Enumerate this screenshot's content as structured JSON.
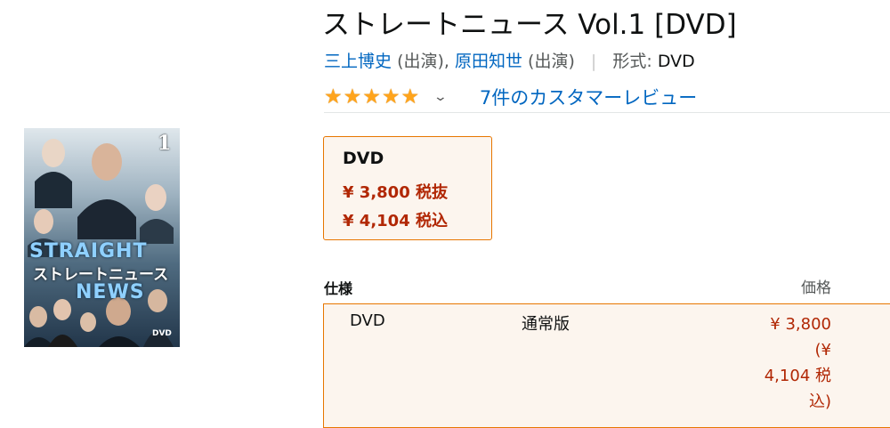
{
  "product": {
    "title": "ストレートニュース Vol.1 [DVD]",
    "cast": [
      {
        "name": "三上博史",
        "role": "(出演)"
      },
      {
        "name": "原田知世",
        "role": "(出演)"
      }
    ],
    "format_label": "形式:",
    "format_value": "DVD",
    "rating_stars": 5,
    "review_link": "7件のカスタマーレビュー"
  },
  "cover": {
    "volume_number": "1",
    "title_en_top": "STRAIGHT",
    "title_jp": "ストレートニュース",
    "title_en_bottom": "NEWS",
    "badge": "DVD"
  },
  "swatch": {
    "label": "DVD",
    "price_ex_tax": "¥ 3,800 税抜",
    "price_in_tax": "¥ 4,104 税込"
  },
  "spec_table": {
    "header_spec": "仕様",
    "header_price": "価格",
    "rows": [
      {
        "format": "DVD",
        "edition": "通常版",
        "price_lines": [
          "¥ 3,800",
          "(¥",
          "4,104 税",
          "込)"
        ]
      }
    ]
  },
  "colors": {
    "link": "#0066c0",
    "price": "#b12704",
    "selected_border": "#e77600",
    "selected_bg": "#fcf5ee",
    "star": "#ffa41c"
  }
}
